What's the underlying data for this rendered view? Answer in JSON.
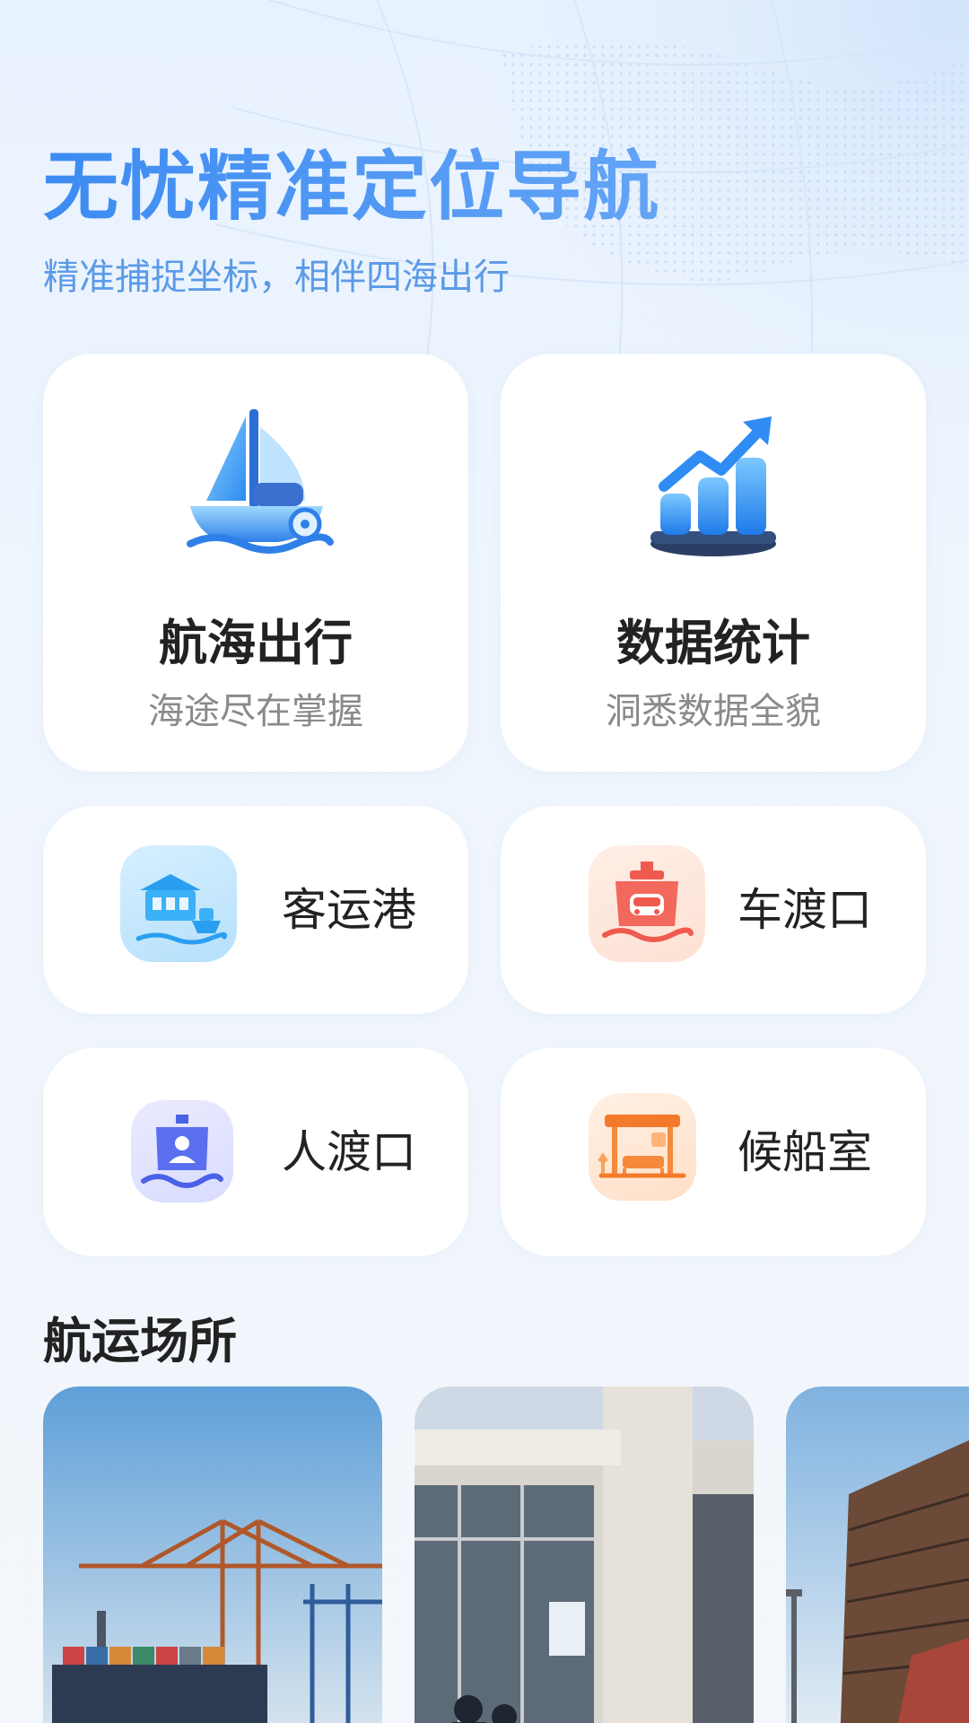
{
  "header": {
    "title": "无忧精准定位导航",
    "subtitle": "精准捕捉坐标，相伴四海出行"
  },
  "feature_cards": [
    {
      "title": "航海出行",
      "subtitle": "海途尽在掌握",
      "icon": "sailboat-icon"
    },
    {
      "title": "数据统计",
      "subtitle": "洞悉数据全貌",
      "icon": "growth-chart-icon"
    }
  ],
  "quick_links": [
    {
      "label": "客运港",
      "icon": "passenger-port-icon",
      "color": "#3aa0f5"
    },
    {
      "label": "车渡口",
      "icon": "car-ferry-icon",
      "color": "#f05a4e"
    },
    {
      "label": "人渡口",
      "icon": "passenger-ferry-icon",
      "color": "#5a6ff0"
    },
    {
      "label": "候船室",
      "icon": "waiting-room-icon",
      "color": "#f58a3a"
    }
  ],
  "section": {
    "title": "航运场所"
  },
  "places": [
    {
      "image": "container-port-photo"
    },
    {
      "image": "terminal-building-photo"
    },
    {
      "image": "ship-under-construction-photo"
    }
  ],
  "colors": {
    "accent": "#4a90f0",
    "background": "#eef5fd"
  }
}
